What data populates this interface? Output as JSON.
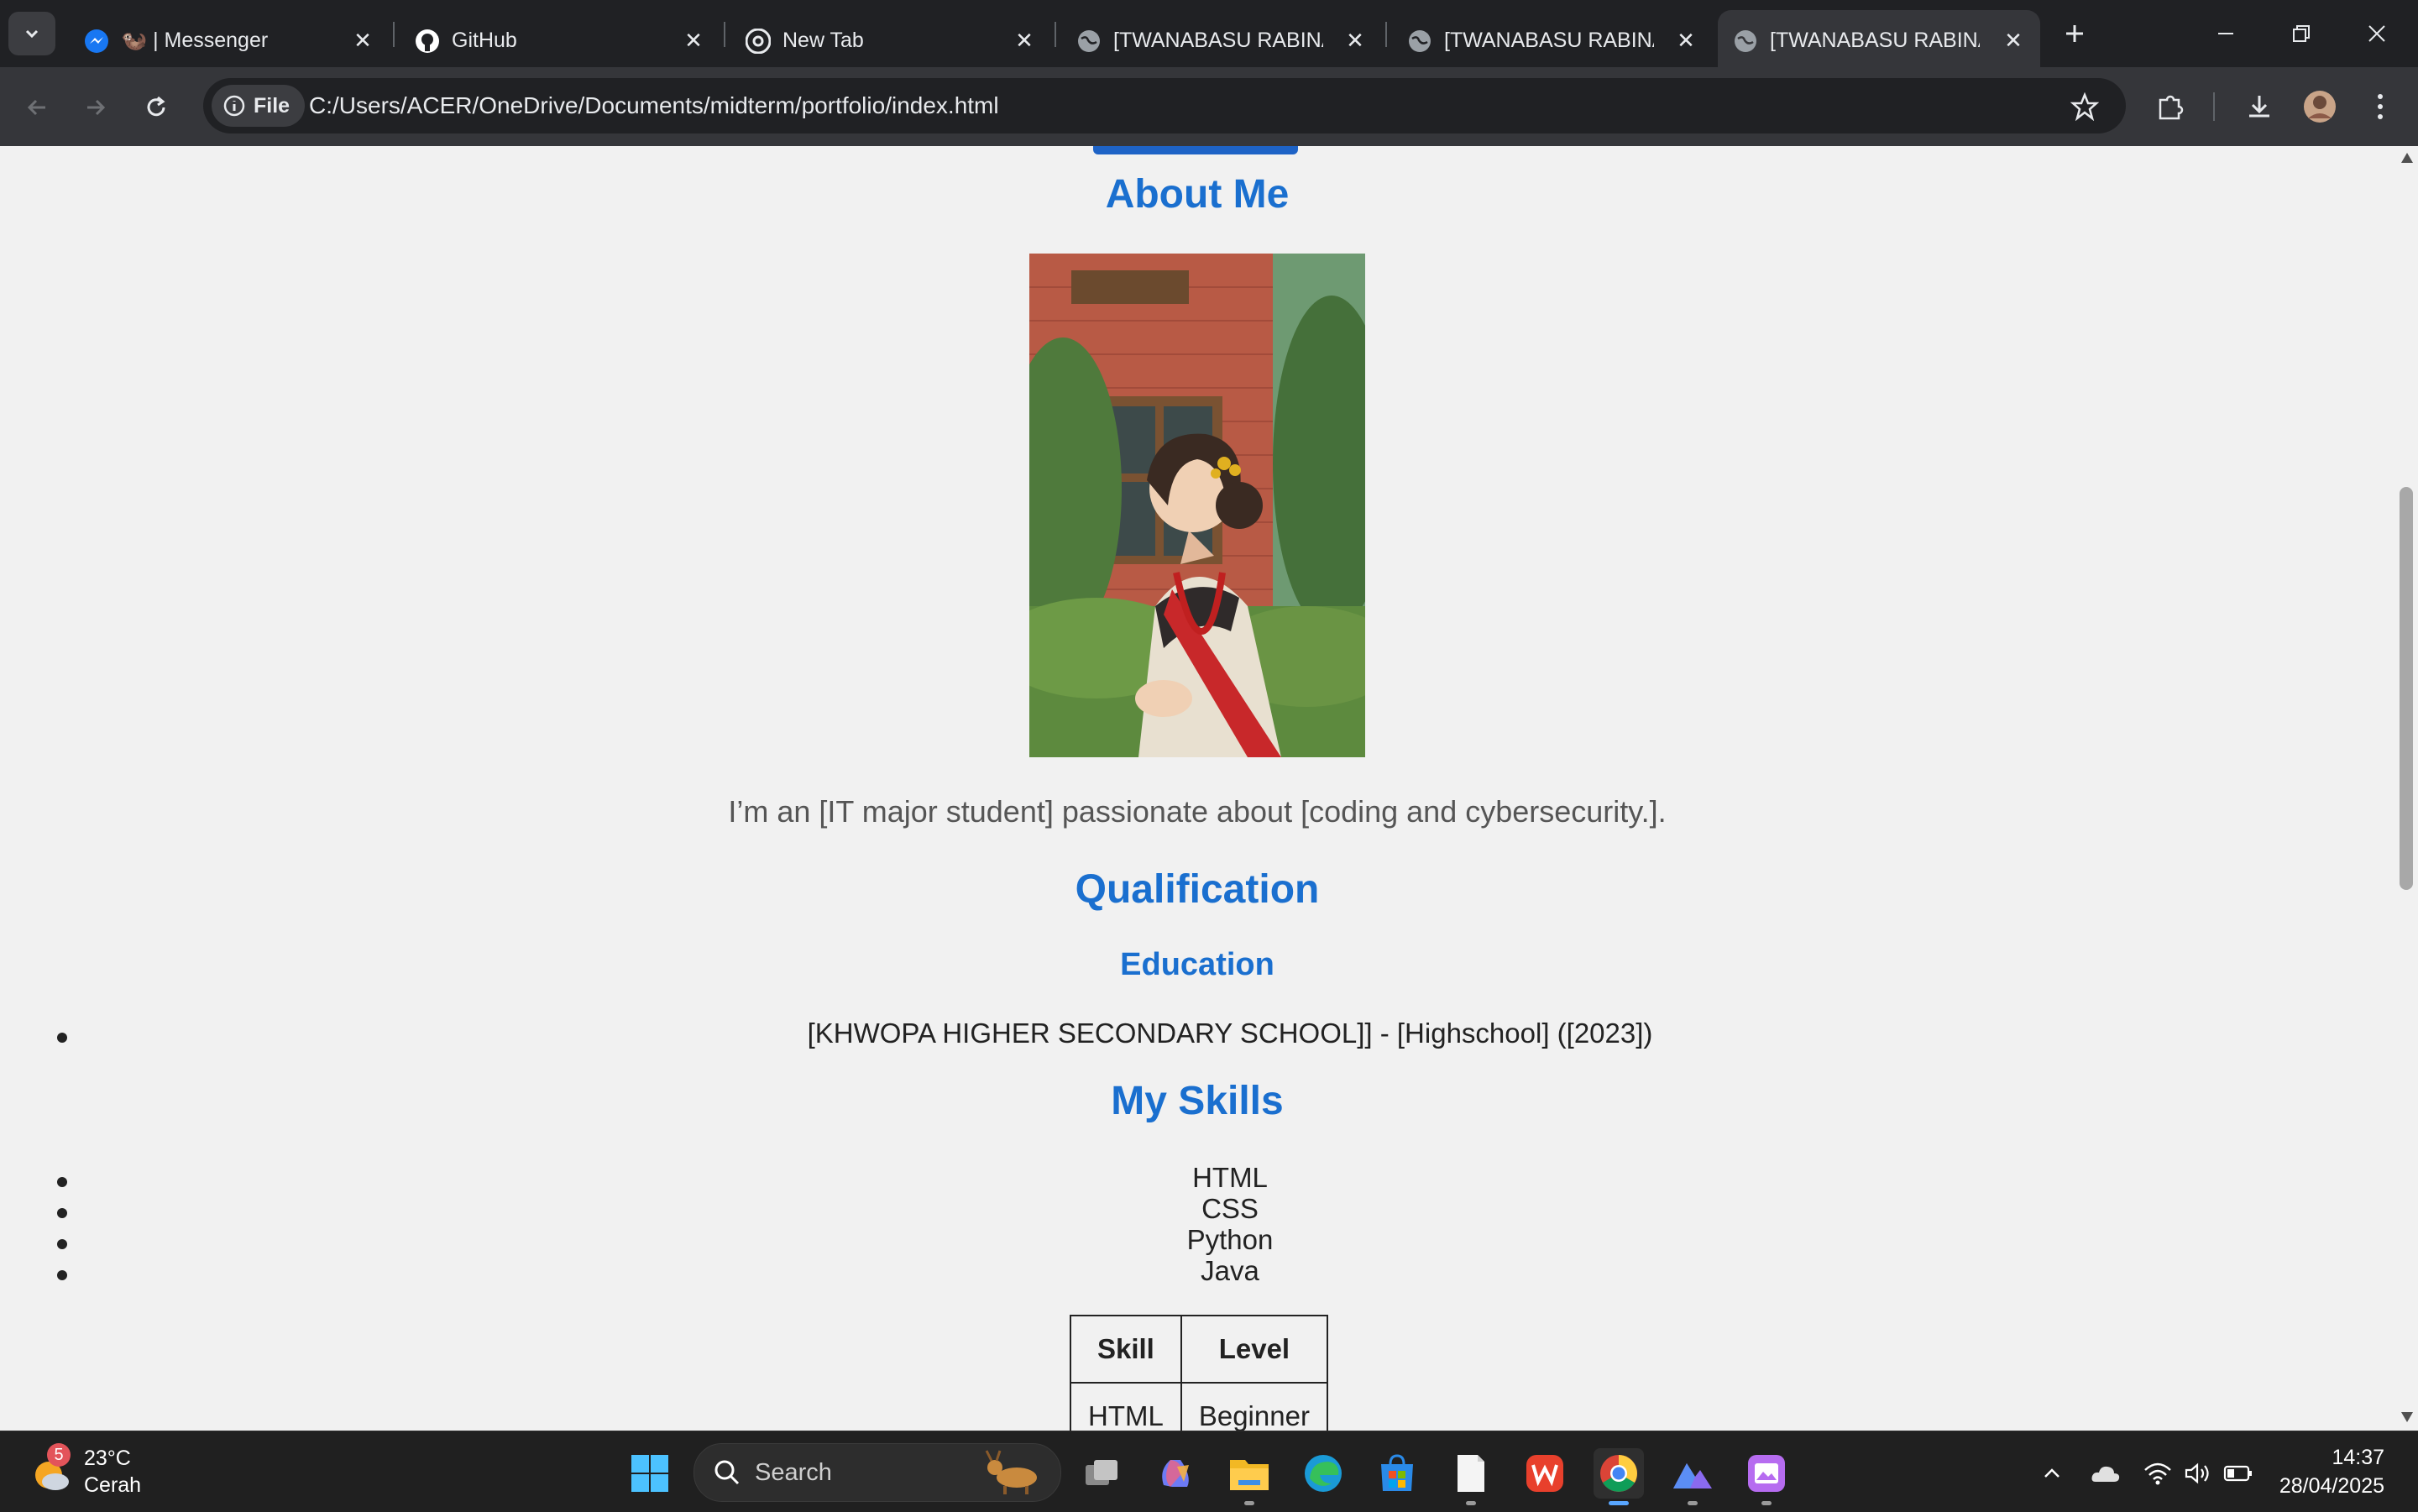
{
  "browser": {
    "tabs": [
      {
        "label": "🦦 | Messenger",
        "icon": "messenger-icon"
      },
      {
        "label": "GitHub",
        "icon": "github-icon"
      },
      {
        "label": "New Tab",
        "icon": "chrome-icon"
      },
      {
        "label": "[TWANABASU RABINA]",
        "icon": "globe-icon"
      },
      {
        "label": "[TWANABASU RABINA]",
        "icon": "globe-icon"
      },
      {
        "label": "[TWANABASU RABINA]",
        "icon": "globe-icon",
        "active": true
      }
    ],
    "omnibox": {
      "chip_label": "File",
      "url": "C:/Users/ACER/OneDrive/Documents/midterm/portfolio/index.html"
    }
  },
  "page": {
    "about": {
      "heading": "About Me",
      "text": "I’m an [IT major student] passionate about [coding and cybersecurity.]."
    },
    "qualification": {
      "heading": "Qualification",
      "education_heading": "Education",
      "education_items": [
        "[KHWOPA HIGHER SECONDARY SCHOOL]] - [Highschool] ([2023])"
      ]
    },
    "skills": {
      "heading": "My Skills",
      "items": [
        "HTML",
        "CSS",
        "Python",
        "Java"
      ],
      "table": {
        "headers": [
          "Skill",
          "Level"
        ],
        "rows": [
          [
            "HTML",
            "Beginner"
          ]
        ]
      }
    }
  },
  "taskbar": {
    "weather": {
      "badge": "5",
      "temp": "23°C",
      "condition": "Cerah"
    },
    "search_label": "Search",
    "clock": {
      "time": "14:37",
      "date": "28/04/2025"
    }
  },
  "colors": {
    "heading_blue": "#1a6fcf",
    "tab_bar": "#202124",
    "toolbar": "#35363a",
    "page_bg": "#f1f1f1",
    "taskbar": "#202020"
  }
}
